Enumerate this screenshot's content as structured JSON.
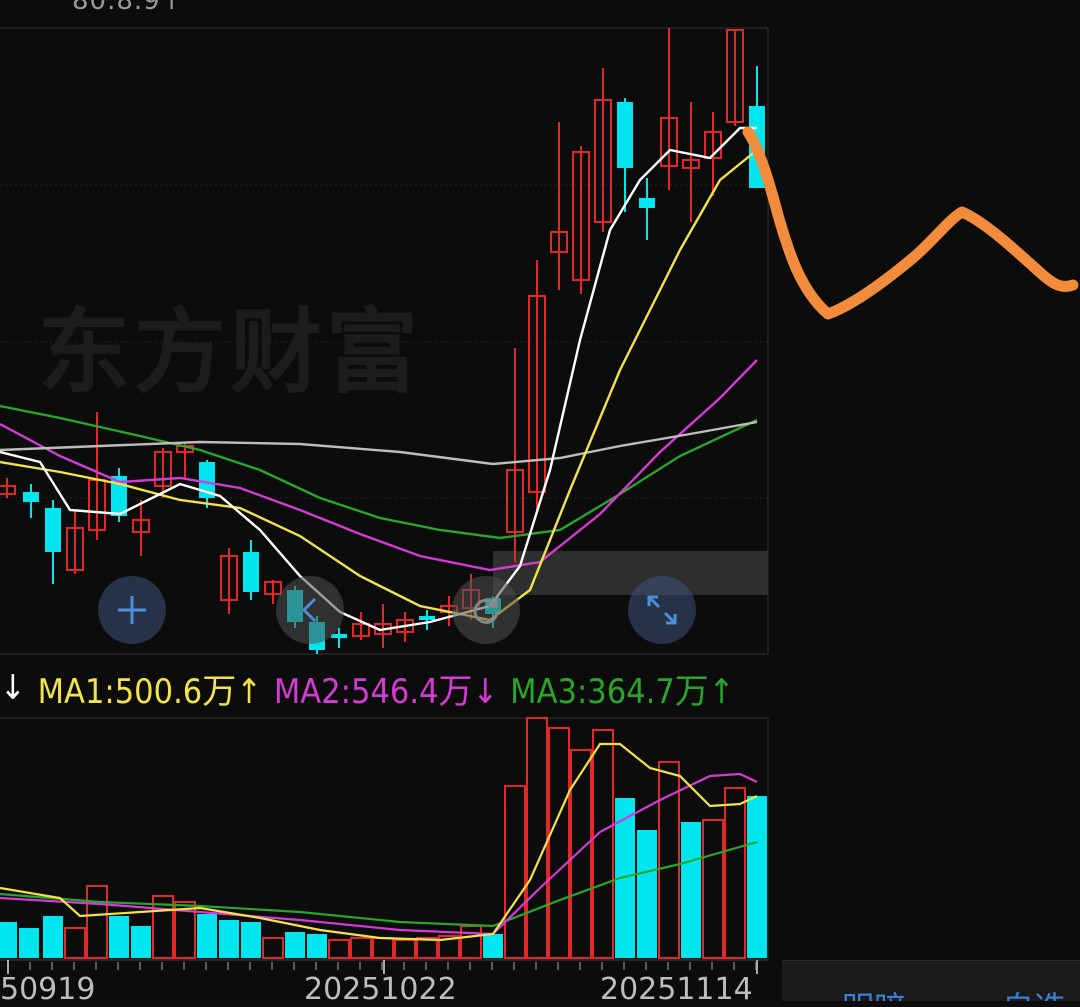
{
  "header": {
    "price_hint": "80.8.9↑"
  },
  "watermark": "东方财富",
  "legend": {
    "prefix": "↓",
    "ma1": "MA1:500.6万↑",
    "ma2": "MA2:546.4万↓",
    "ma3": "MA3:364.7万↑",
    "colors": {
      "ma1": "#f2e34a",
      "ma2": "#d43bd4",
      "ma3": "#2aa52a"
    }
  },
  "date_axis": [
    "50919",
    "20251022",
    "20251114"
  ],
  "controls": [
    "plus-icon",
    "chevron-left-icon",
    "refresh-icon",
    "expand-icon"
  ],
  "bottom_bar": {
    "left": "明暗",
    "right": "自选"
  },
  "colors": {
    "up": "#e02828",
    "down": "#00e5ee",
    "ma_white": "#ffffff",
    "ma_yellow": "#f2e34a",
    "ma_magenta": "#d43bd4",
    "ma_green": "#2aa52a",
    "ma_grey": "#bdbdbd",
    "annotation": "#f28c3c"
  }
}
